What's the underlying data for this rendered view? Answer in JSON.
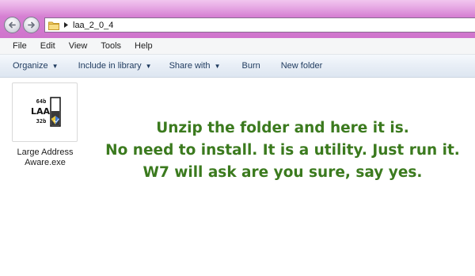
{
  "address": {
    "crumb": "laa_2_0_4"
  },
  "menu": [
    "File",
    "Edit",
    "View",
    "Tools",
    "Help"
  ],
  "commands": {
    "organize": "Organize",
    "include": "Include in library",
    "share": "Share with",
    "burn": "Burn",
    "new_folder": "New folder"
  },
  "file": {
    "icon": "laa-app-icon",
    "icon_text": {
      "top": "64b",
      "mid": "LAA",
      "bottom": "32b"
    },
    "name_line1": "Large Address",
    "name_line2": "Aware.exe"
  },
  "annotation": {
    "line1": "Unzip the folder and here it is.",
    "line2": "No need to install. It is a utility. Just run it.",
    "line3": "W7 will ask are you sure, say yes.",
    "color": "#3b7a1e"
  }
}
